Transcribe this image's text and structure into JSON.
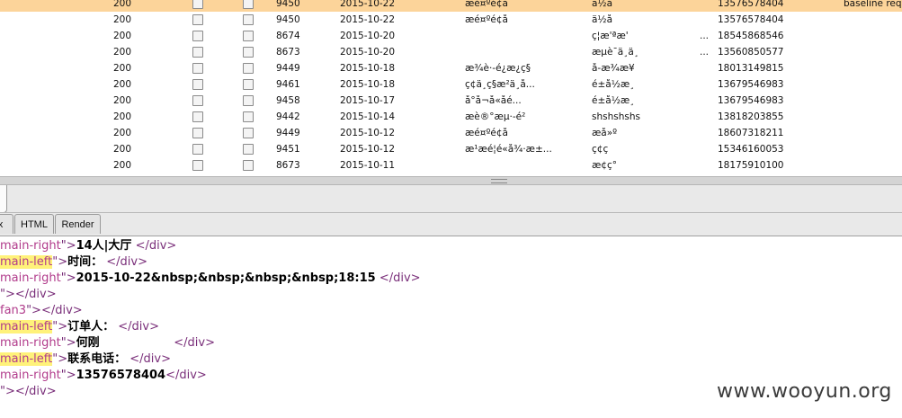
{
  "table": {
    "rows": [
      {
        "status": "200",
        "id": "9450",
        "date": "2015-10-22",
        "title": "æé¤ºé¢å",
        "name": "ä½å",
        "ell": "",
        "phone": "13576578404",
        "comment": "baseline requ",
        "selected": true
      },
      {
        "status": "200",
        "id": "9450",
        "date": "2015-10-22",
        "title": "æé¤ºé¢å",
        "name": "ä½å",
        "ell": "",
        "phone": "13576578404",
        "comment": "",
        "selected": false
      },
      {
        "status": "200",
        "id": "8674",
        "date": "2015-10-20",
        "title": "",
        "name": "ç¦æ'ªæ'",
        "ell": "...",
        "phone": "18545868546",
        "comment": "",
        "selected": false
      },
      {
        "status": "200",
        "id": "8673",
        "date": "2015-10-20",
        "title": "",
        "name": "æµè¯ä¸ä¸",
        "ell": "...",
        "phone": "13560850577",
        "comment": "",
        "selected": false
      },
      {
        "status": "200",
        "id": "9449",
        "date": "2015-10-18",
        "title": "æ¾è·-é¿æ¿ç§",
        "name": "å-æ¾æ¥",
        "ell": "",
        "phone": "18013149815",
        "comment": "",
        "selected": false
      },
      {
        "status": "200",
        "id": "9461",
        "date": "2015-10-18",
        "title": "ç¢ä¸ç§æ²ä¸å...",
        "name": "é±å½æ¸",
        "ell": "",
        "phone": "13679546983",
        "comment": "",
        "selected": false
      },
      {
        "status": "200",
        "id": "9458",
        "date": "2015-10-17",
        "title": "å°å¬å«åé...",
        "name": "é±å½æ¸",
        "ell": "",
        "phone": "13679546983",
        "comment": "",
        "selected": false
      },
      {
        "status": "200",
        "id": "9442",
        "date": "2015-10-14",
        "title": "æè®°æµ·-é²",
        "name": "shshshshs",
        "ell": "",
        "phone": "13818203855",
        "comment": "",
        "selected": false
      },
      {
        "status": "200",
        "id": "9449",
        "date": "2015-10-12",
        "title": "æé¤ºé¢å",
        "name": "æå»º",
        "ell": "",
        "phone": "18607318211",
        "comment": "",
        "selected": false
      },
      {
        "status": "200",
        "id": "9451",
        "date": "2015-10-12",
        "title": "æ¹æé¦é«å¾·æ±...",
        "name": "ç¢ç",
        "ell": "",
        "phone": "15346160053",
        "comment": "",
        "selected": false
      },
      {
        "status": "200",
        "id": "8673",
        "date": "2015-10-11",
        "title": "",
        "name": "æ¢ç°",
        "ell": "",
        "phone": "18175910100",
        "comment": "",
        "selected": false
      }
    ]
  },
  "tabs": {
    "hex": "x",
    "html": "HTML",
    "render": "Render"
  },
  "code": {
    "l1": {
      "attr": "main-right",
      "mid": "\">",
      "text": "14人|大厅",
      "close": "</div>"
    },
    "l2": {
      "attr": "main-left",
      "mid": "\">",
      "text": "时间：",
      "close": "</div>"
    },
    "l3": {
      "attr": "main-right",
      "mid": "\">",
      "text": "2015-10-22&nbsp;&nbsp;&nbsp;&nbsp;18:15",
      "close": "</div>"
    },
    "l4": {
      "pre": "\">",
      "close": "</div>"
    },
    "l5": {
      "attr": "fan3",
      "mid": "\">",
      "close": "</div>"
    },
    "l6": {
      "attr": "main-left",
      "mid": "\">",
      "text": "订单人：",
      "close": "</div>"
    },
    "l7": {
      "attr": "main-right",
      "mid": "\">",
      "text": "何刚",
      "spacer": "                    ",
      "close": "</div>"
    },
    "l8": {
      "attr": "main-left",
      "mid": "\">",
      "text": "联系电话：",
      "close": "</div>"
    },
    "l9": {
      "attr": "main-right",
      "mid": "\">",
      "text": "13576578404",
      "close": "</div>"
    },
    "l10": {
      "pre": "\">",
      "close": "</div>"
    }
  },
  "watermark": "www.wooyun.org",
  "colors": {
    "selected_row": "#fcd49a",
    "highlight": "#fff27a",
    "attr": "#b13b8b",
    "tag": "#7a2f7a"
  }
}
